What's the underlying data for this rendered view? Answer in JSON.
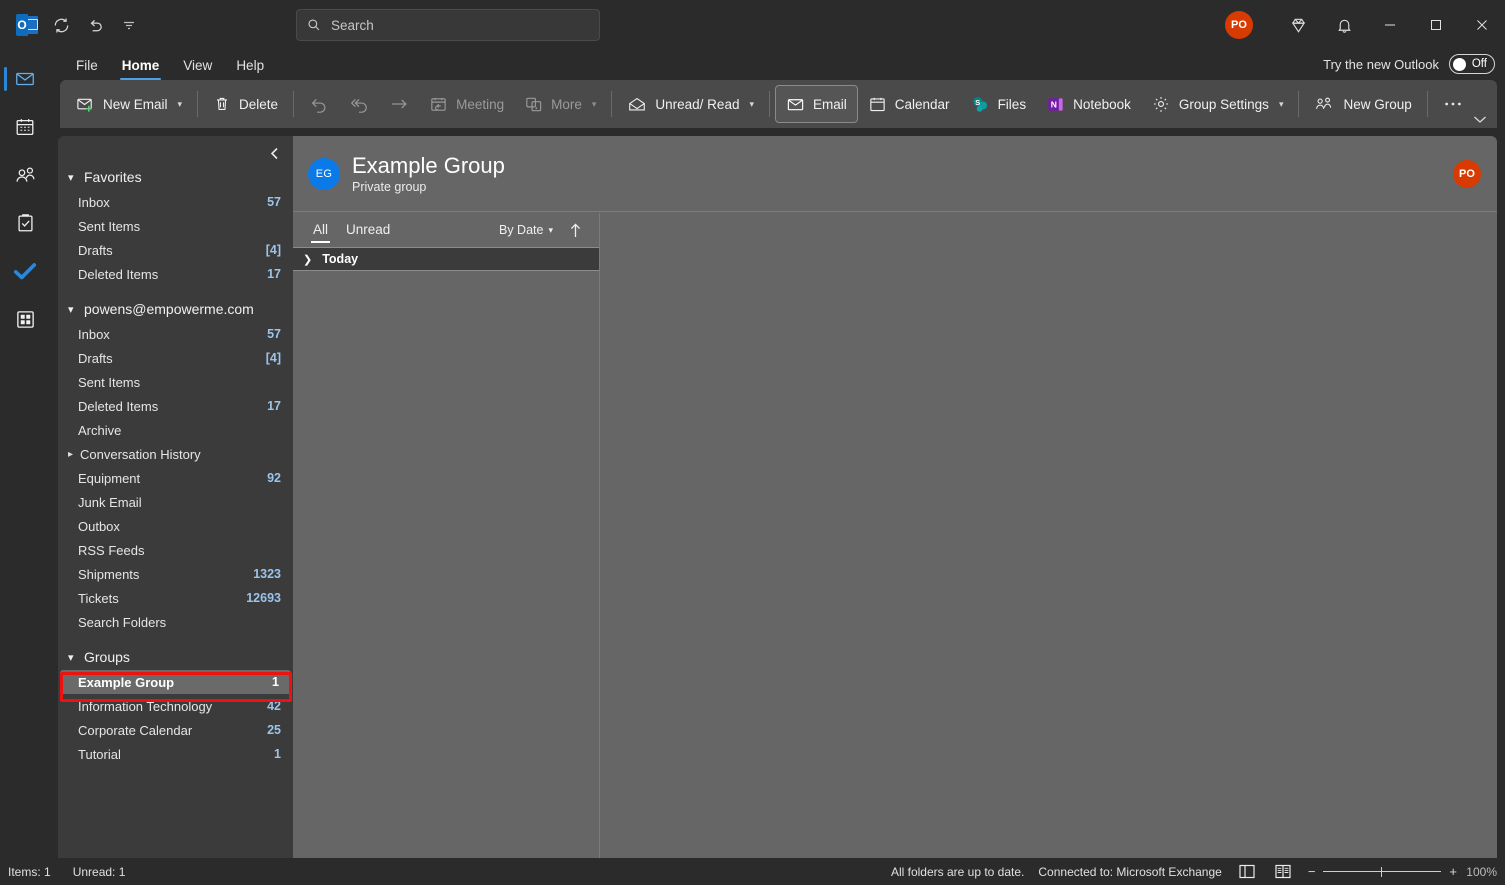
{
  "titlebar": {
    "quick_access": [
      {
        "name": "outlook-logo-icon",
        "label": "O"
      },
      {
        "name": "sync-icon",
        "label": "Sync"
      },
      {
        "name": "undo-icon",
        "label": "Undo"
      },
      {
        "name": "customize-qat-icon",
        "label": "Customize Quick Access Toolbar"
      }
    ],
    "search": {
      "placeholder": "Search",
      "value": ""
    },
    "account_initials": "PO",
    "right_icons": [
      {
        "name": "diamond-premium-icon",
        "label": "Microsoft 365 Premium"
      },
      {
        "name": "notifications-bell-icon",
        "label": "Notifications"
      }
    ],
    "window_controls": [
      {
        "name": "minimize-button",
        "label": "Minimize"
      },
      {
        "name": "maximize-button",
        "label": "Maximize"
      },
      {
        "name": "close-button",
        "label": "Close"
      }
    ]
  },
  "menubar": {
    "items": [
      {
        "label": "File",
        "active": false
      },
      {
        "label": "Home",
        "active": true
      },
      {
        "label": "View",
        "active": false
      },
      {
        "label": "Help",
        "active": false
      }
    ],
    "try_new_outlook": {
      "label": "Try the new Outlook",
      "toggle_state": "Off"
    }
  },
  "ribbon": {
    "items": [
      {
        "label": "New Email",
        "icon": "new-email-icon",
        "caret": true,
        "disabled": false,
        "boxed": false
      },
      {
        "sep": true
      },
      {
        "label": "Delete",
        "icon": "trash-icon",
        "caret": false,
        "disabled": false,
        "boxed": false
      },
      {
        "sep": true
      },
      {
        "label": "",
        "icon": "undo-arrow-icon",
        "caret": false,
        "disabled": true,
        "boxed": false
      },
      {
        "label": "",
        "icon": "reply-all-arrow-icon",
        "caret": false,
        "disabled": true,
        "boxed": false
      },
      {
        "label": "",
        "icon": "forward-arrow-icon",
        "caret": false,
        "disabled": true,
        "boxed": false
      },
      {
        "label": "Meeting",
        "icon": "meeting-icon",
        "caret": false,
        "disabled": true,
        "boxed": false
      },
      {
        "label": "More",
        "icon": "more-windows-icon",
        "caret": true,
        "disabled": true,
        "boxed": false
      },
      {
        "sep": true
      },
      {
        "label": "Unread/ Read",
        "icon": "open-envelope-icon",
        "caret": true,
        "disabled": false,
        "boxed": false
      },
      {
        "sep": true
      },
      {
        "label": "Email",
        "icon": "email-icon",
        "caret": false,
        "disabled": false,
        "boxed": true
      },
      {
        "label": "Calendar",
        "icon": "calendar-icon",
        "caret": false,
        "disabled": false,
        "boxed": false
      },
      {
        "label": "Files",
        "icon": "sharepoint-files-icon",
        "caret": false,
        "disabled": false,
        "boxed": false
      },
      {
        "label": "Notebook",
        "icon": "onenote-notebook-icon",
        "caret": false,
        "disabled": false,
        "boxed": false
      },
      {
        "label": "Group Settings",
        "icon": "gear-icon",
        "caret": true,
        "disabled": false,
        "boxed": false
      },
      {
        "sep": true
      },
      {
        "label": "New Group",
        "icon": "people-group-icon",
        "caret": false,
        "disabled": false,
        "boxed": false
      },
      {
        "sep": true
      },
      {
        "label": "",
        "icon": "overflow-ellipsis-icon",
        "caret": false,
        "disabled": false,
        "boxed": false
      }
    ],
    "expand_label": "Expand the Ribbon"
  },
  "rail": {
    "items": [
      {
        "name": "rail-item-mail",
        "label": "Mail",
        "icon": "mail-icon",
        "active": true
      },
      {
        "name": "rail-item-calendar",
        "label": "Calendar",
        "icon": "calendar-icon",
        "active": false
      },
      {
        "name": "rail-item-people",
        "label": "People",
        "icon": "people-icon",
        "active": false
      },
      {
        "name": "rail-item-tasks",
        "label": "Tasks",
        "icon": "clipboard-check-icon",
        "active": false
      },
      {
        "name": "rail-item-todo",
        "label": "To Do",
        "icon": "blue-check-icon",
        "active": false
      },
      {
        "name": "rail-item-apps",
        "label": "More apps",
        "icon": "apps-grid-icon",
        "active": false
      }
    ]
  },
  "folder_pane": {
    "collapse_label": "Collapse the Folder Pane",
    "sections": [
      {
        "title": "Favorites",
        "expanded": true,
        "items": [
          {
            "label": "Inbox",
            "count": "57"
          },
          {
            "label": "Sent Items",
            "count": ""
          },
          {
            "label": "Drafts",
            "count": "[4]"
          },
          {
            "label": "Deleted Items",
            "count": "17"
          }
        ]
      },
      {
        "title": "powens@empowerme.com",
        "expanded": true,
        "items": [
          {
            "label": "Inbox",
            "count": "57"
          },
          {
            "label": "Drafts",
            "count": "[4]"
          },
          {
            "label": "Sent Items",
            "count": ""
          },
          {
            "label": "Deleted Items",
            "count": "17"
          },
          {
            "label": "Archive",
            "count": ""
          },
          {
            "label": "Conversation History",
            "count": "",
            "expandable": true
          },
          {
            "label": "Equipment",
            "count": "92"
          },
          {
            "label": "Junk Email",
            "count": ""
          },
          {
            "label": "Outbox",
            "count": ""
          },
          {
            "label": "RSS Feeds",
            "count": ""
          },
          {
            "label": "Shipments",
            "count": "1323"
          },
          {
            "label": "Tickets",
            "count": "12693"
          },
          {
            "label": "Search Folders",
            "count": ""
          }
        ]
      },
      {
        "title": "Groups",
        "expanded": true,
        "items": [
          {
            "label": "Example Group",
            "count": "1",
            "selected": true
          },
          {
            "label": "Information Technology",
            "count": "42"
          },
          {
            "label": "Corporate Calendar",
            "count": "25"
          },
          {
            "label": "Tutorial",
            "count": "1"
          }
        ]
      }
    ]
  },
  "group_header": {
    "avatar_initials": "EG",
    "title": "Example Group",
    "subtitle": "Private group",
    "user_initials": "PO"
  },
  "message_list": {
    "tabs": [
      {
        "label": "All",
        "active": true
      },
      {
        "label": "Unread",
        "active": false
      }
    ],
    "sort_label": "By Date",
    "sort_direction_label": "Ascending",
    "groups": [
      {
        "label": "Today",
        "expanded": false,
        "messages": []
      }
    ]
  },
  "status_bar": {
    "items_label": "Items: 1",
    "unread_label": "Unread: 1",
    "sync_status": "All folders are up to date.",
    "connection_status": "Connected to: Microsoft Exchange",
    "view_buttons": [
      {
        "name": "normal-view-button",
        "label": "Normal view"
      },
      {
        "name": "reading-view-button",
        "label": "Reading view"
      }
    ],
    "zoom_out_label": "−",
    "zoom_in_label": "+",
    "zoom_level": "100%"
  },
  "colors": {
    "window_bg": "#2b2b2b",
    "ribbon_bg": "#4a4a4a",
    "folder_pane_bg": "#3b3b3b",
    "content_bg": "#666666",
    "accent_blue": "#2b88d8",
    "count_blue": "#9bc4ea",
    "avatar_orange": "#d83b01",
    "group_avatar_blue": "#0a7ae8",
    "highlight_red": "#ee1111"
  }
}
